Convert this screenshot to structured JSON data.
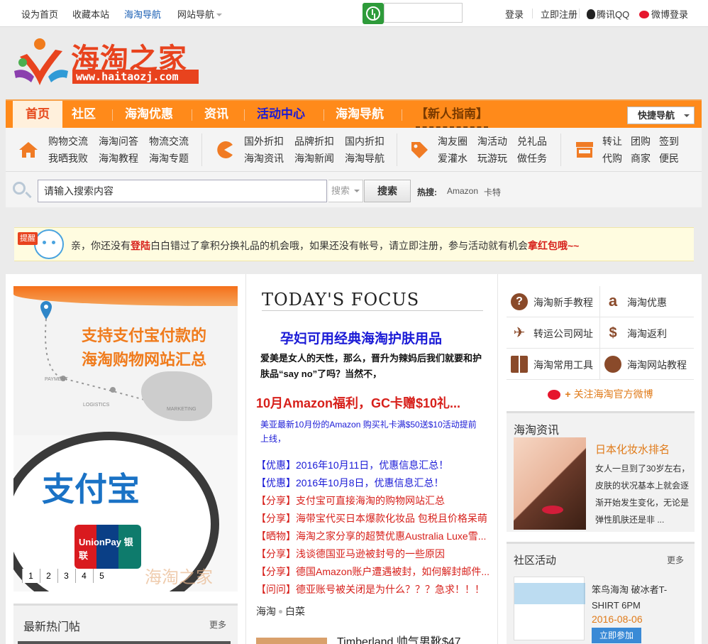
{
  "topbar": {
    "set_home": "设为首页",
    "bookmark": "收藏本站",
    "nav_haitao": "海淘导航",
    "nav_sites": "网站导航",
    "login": "登录",
    "register": "立即注册",
    "qq": "腾讯QQ",
    "weibo": "微博登录"
  },
  "logo": {
    "text": "海淘之家",
    "url": "www.haitaozj.com"
  },
  "mainnav": {
    "items": [
      "首页",
      "社区",
      "海淘优惠",
      "资讯",
      "活动中心",
      "海淘导航",
      "【新人指南】"
    ],
    "quick": "快捷导航"
  },
  "subnav": {
    "g1": [
      "购物交流",
      "海淘问答",
      "物流交流",
      "我晒我败",
      "海淘教程",
      "海淘专题"
    ],
    "g2": [
      "国外折扣",
      "品牌折扣",
      "国内折扣",
      "海淘资讯",
      "海淘新闻",
      "海淘导航"
    ],
    "g3": [
      "淘友圈",
      "淘活动",
      "兑礼品",
      "爱灌水",
      "玩游玩",
      "做任务"
    ],
    "g4": [
      "转让",
      "团购",
      "签到",
      "代购",
      "商家",
      "便民"
    ]
  },
  "search": {
    "placeholder": "请输入搜索内容",
    "type": "搜索",
    "button": "搜索",
    "hot_label": "热搜:",
    "hot_tags": [
      "Amazon",
      "卡特"
    ]
  },
  "notice": {
    "badge": "提醒",
    "t1": "亲，你还没有",
    "login": "登陆",
    "t2": "白白错过了拿积分换礼品的机会哦，如果还没有帐号，请",
    "register": "立即注册",
    "t3": "，参与活动就有机会",
    "red": "拿红包哦~~"
  },
  "slider": {
    "head1": "支持支付宝付款的",
    "head2": "海淘购物网站汇总",
    "labels": [
      "PAYMENT",
      "LOGISTICS",
      "MARKETING"
    ],
    "alipay": "支付宝",
    "unionpay": "UnionPay 银联",
    "watermark": "海淘之家",
    "dots": [
      "1",
      "2",
      "3",
      "4",
      "5"
    ]
  },
  "focus": {
    "title": "TODAY'S FOCUS",
    "h1": "孕妇可用经典海淘护肤用品",
    "p1": "爱美是女人的天性，那么，晋升为辣妈后我们就要和护肤品“say no”了吗？当然不，",
    "h2": "10月Amazon福利，GC卡赠$10礼...",
    "p2": "美亚最新10月份的Amazon 购买礼卡满$50送$10活动提前上线，",
    "list": [
      "【优惠】2016年10月11日，优惠信息汇总！",
      "【优惠】2016年10月8日，优惠信息汇总！",
      "【分享】支付宝可直接海淘的购物网站汇总",
      "【分享】海带宝代买日本爆款化妆品 包税且价格呆萌",
      "【晒物】海淘之家分享的超赞优惠Australia Luxe雪...",
      "【分享】浅谈德国亚马逊被封号的一些原因",
      "【分享】德国Amazon账户遭遇被封，如何解封邮件...",
      "【问问】德亚账号被关闭是为什么？？？急求！！！"
    ],
    "tags": [
      "海淘",
      "白菜"
    ],
    "timberland": "Timberland 帅气男靴$47"
  },
  "right": {
    "tools": [
      "海淘新手教程",
      "海淘优惠",
      "转运公司网址",
      "海淘返利",
      "海淘常用工具",
      "海淘网站教程"
    ],
    "weibo_follow": "关注海淘官方微博",
    "news_title": "海淘资讯",
    "news_h": "日本化妆水排名",
    "news_p": "女人一旦到了30岁左右，皮肤的状况基本上就会逐渐开始发生变化，无论是弹性肌肤还是非 ...",
    "comm_title": "社区活动",
    "comm_more": "更多",
    "comm_h": "笨鸟海淘 破冰者T-SHIRT 6PM",
    "comm_date": "2016-08-06",
    "comm_btn": "立即参加"
  },
  "hot": {
    "title": "最新热门帖",
    "more": "更多"
  },
  "colors": {
    "orange": "#ff8a1a",
    "red": "#d7201b",
    "blue": "#1a1ad6"
  }
}
